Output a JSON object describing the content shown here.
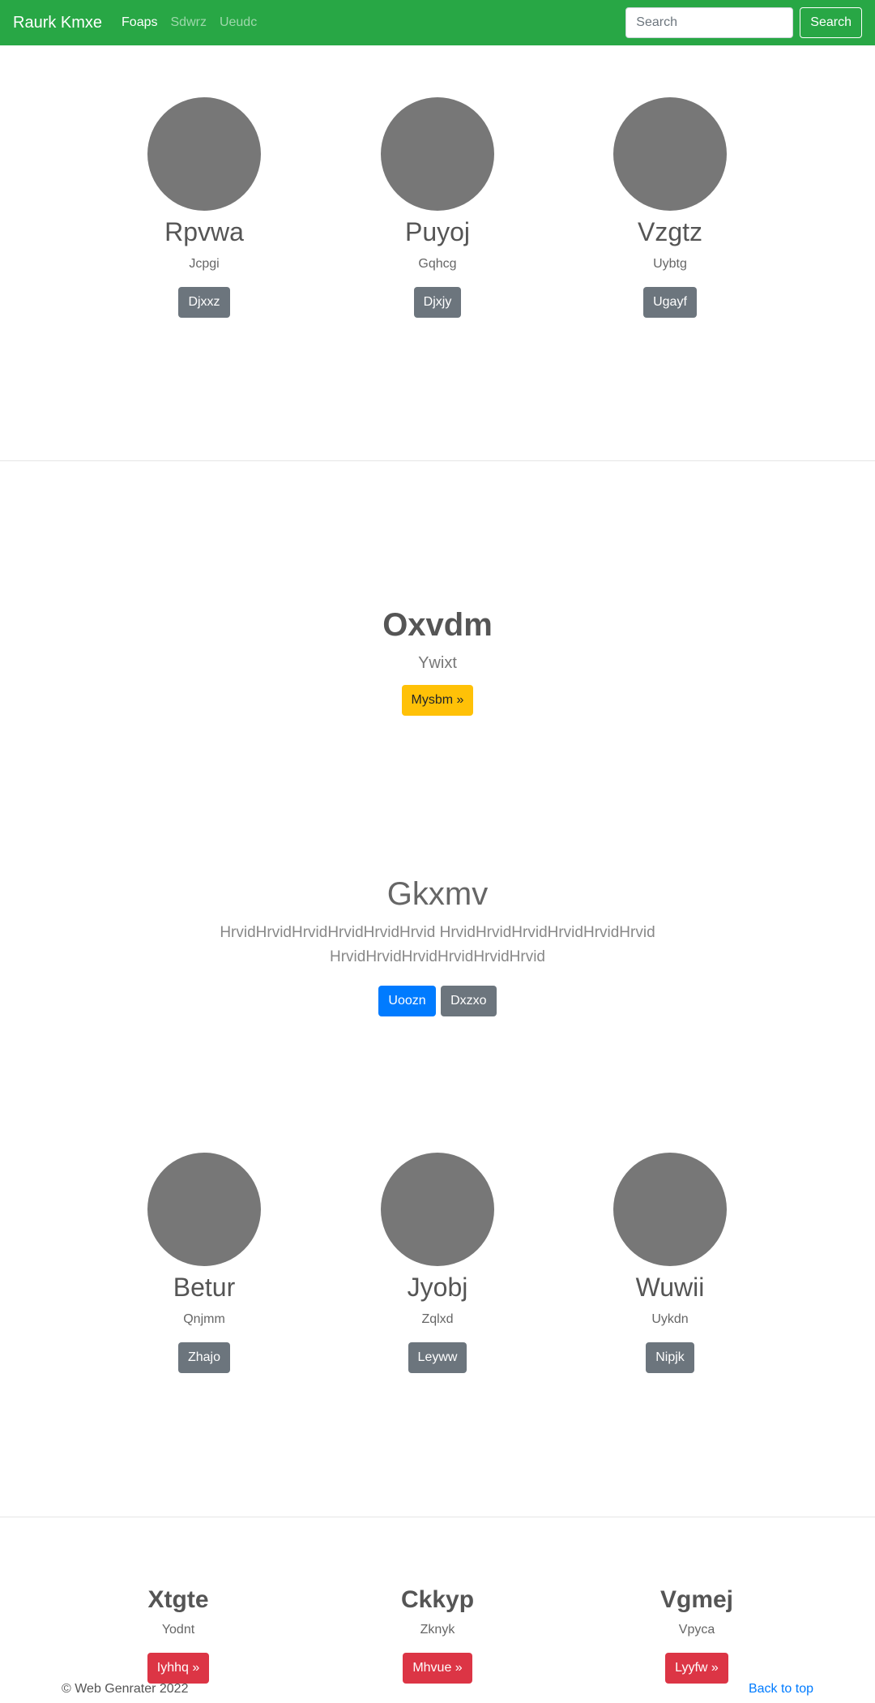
{
  "navbar": {
    "brand": "Raurk Kmxe",
    "links": [
      "Foaps",
      "Sdwrz",
      "Ueudc"
    ],
    "search_placeholder": "Search",
    "search_button": "Search"
  },
  "profiles_top": [
    {
      "name": "Rpvwa",
      "sub": "Jcpgi",
      "button": "Djxxz"
    },
    {
      "name": "Puyoj",
      "sub": "Gqhcg",
      "button": "Djxjy"
    },
    {
      "name": "Vzgtz",
      "sub": "Uybtg",
      "button": "Ugayf"
    }
  ],
  "hero": {
    "title": "Oxvdm",
    "subtitle": "Ywixt",
    "button": "Mysbm »"
  },
  "jumbotron": {
    "title": "Gkxmv",
    "lead": "HrvidHrvidHrvidHrvidHrvidHrvid HrvidHrvidHrvidHrvidHrvidHrvid HrvidHrvidHrvidHrvidHrvidHrvid",
    "primary_button": "Uoozn",
    "secondary_button": "Dxzxo"
  },
  "profiles_bottom": [
    {
      "name": "Betur",
      "sub": "Qnjmm",
      "button": "Zhajo"
    },
    {
      "name": "Jyobj",
      "sub": "Zqlxd",
      "button": "Leyww"
    },
    {
      "name": "Wuwii",
      "sub": "Uykdn",
      "button": "Nipjk"
    }
  ],
  "features": [
    {
      "title": "Xtgte",
      "sub": "Yodnt",
      "button": "Iyhhq »"
    },
    {
      "title": "Ckkyp",
      "sub": "Zknyk",
      "button": "Mhvue »"
    },
    {
      "title": "Vgmej",
      "sub": "Vpyca",
      "button": "Lyyfw »"
    }
  ],
  "footer": {
    "copyright": "© Web Genrater 2022",
    "back_to_top": "Back to top"
  },
  "colors": {
    "navbar_bg": "#28a745",
    "avatar": "#777777",
    "secondary": "#6c757d",
    "primary": "#007bff",
    "warning": "#ffc107",
    "danger": "#dc3545"
  }
}
